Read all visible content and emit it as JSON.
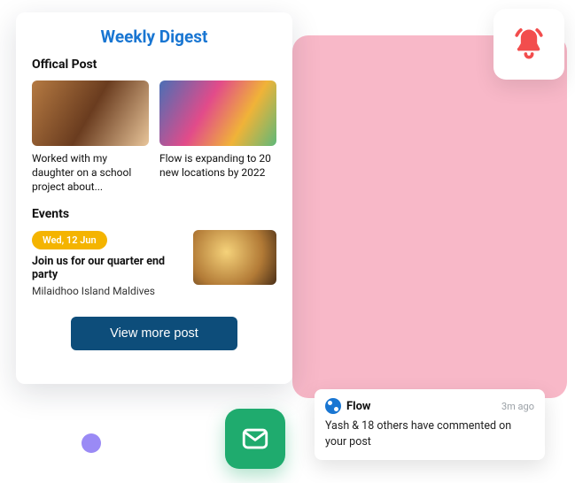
{
  "digest": {
    "title": "Weekly Digest",
    "official_section": "Offical Post",
    "posts": [
      {
        "caption": "Worked with my daughter on a school project about..."
      },
      {
        "caption": "Flow is expanding to 20 new locations by 2022"
      }
    ],
    "events_section": "Events",
    "event": {
      "date": "Wed, 12 Jun",
      "title": "Join us for our quarter end party",
      "location": "Milaidhoo Island Maldives"
    },
    "view_more": "View more post"
  },
  "notification": {
    "app": "Flow",
    "time": "3m ago",
    "body": "Yash & 18 others have commented on your post"
  }
}
